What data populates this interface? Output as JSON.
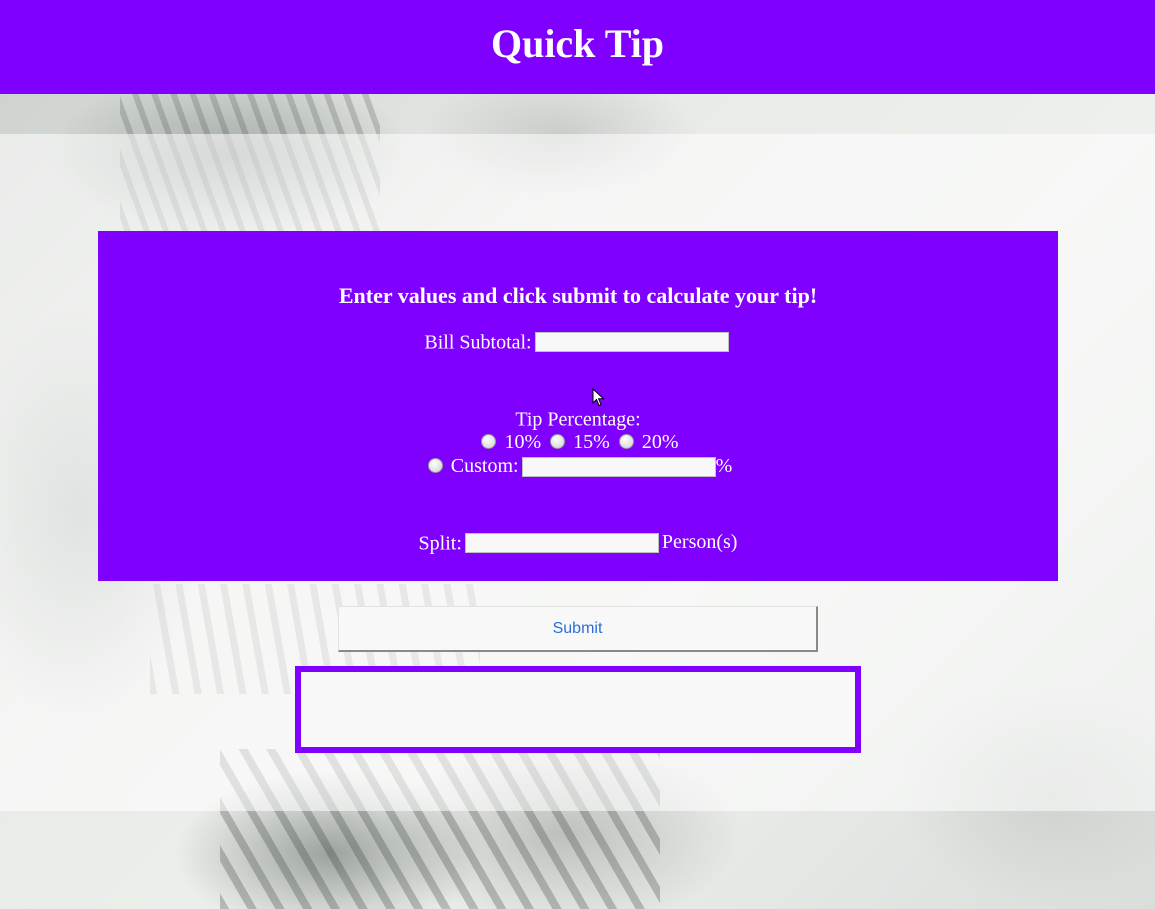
{
  "app": {
    "title": "Quick Tip"
  },
  "form": {
    "instructions": "Enter values and click submit to calculate your tip!",
    "bill_subtotal": {
      "label": "Bill Subtotal:",
      "value": ""
    },
    "tip_percentage": {
      "label": "Tip Percentage:",
      "options": [
        "10%",
        "15%",
        "20%"
      ],
      "custom_label": "Custom:",
      "custom_value": "",
      "custom_suffix": "%"
    },
    "split": {
      "label": "Split:",
      "value": "",
      "suffix": "Person(s)"
    },
    "submit_label": "Submit"
  },
  "result": {
    "text": ""
  },
  "colors": {
    "accent": "#8000ff",
    "panel_text": "#ffffff",
    "submit_text": "#2a6fd6"
  }
}
